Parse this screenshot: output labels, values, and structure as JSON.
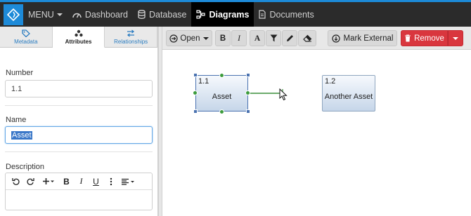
{
  "nav": {
    "menu_label": "MENU",
    "items": [
      {
        "label": "Dashboard",
        "icon": "dashboard-icon"
      },
      {
        "label": "Database",
        "icon": "database-icon"
      },
      {
        "label": "Diagrams",
        "icon": "diagram-icon",
        "active": true
      },
      {
        "label": "Documents",
        "icon": "document-icon"
      }
    ]
  },
  "left_panel": {
    "tabs": [
      {
        "label": "Metadata",
        "icon": "tag-icon"
      },
      {
        "label": "Attributes",
        "icon": "attributes-icon",
        "active": true
      },
      {
        "label": "Relationships",
        "icon": "exchange-icon"
      }
    ],
    "fields": {
      "number_label": "Number",
      "number_value": "1.1",
      "name_label": "Name",
      "name_value": "Asset",
      "description_label": "Description"
    },
    "editor_tools": [
      "undo-icon",
      "redo-icon",
      "insert-icon",
      "bold-icon",
      "italic-icon",
      "underline-icon",
      "more-icon",
      "align-icon"
    ]
  },
  "toolbar": {
    "open_label": "Open",
    "bold_label": "B",
    "italic_label": "I",
    "font_label": "A",
    "mark_external_label": "Mark External",
    "remove_label": "Remove"
  },
  "canvas": {
    "nodes": [
      {
        "id": "1.1",
        "name": "Asset",
        "selected": true
      },
      {
        "id": "1.2",
        "name": "Another Asset",
        "selected": false
      }
    ]
  },
  "colors": {
    "accent": "#1d8ad8",
    "danger": "#d9363e",
    "handle": "#3c9b3c"
  }
}
